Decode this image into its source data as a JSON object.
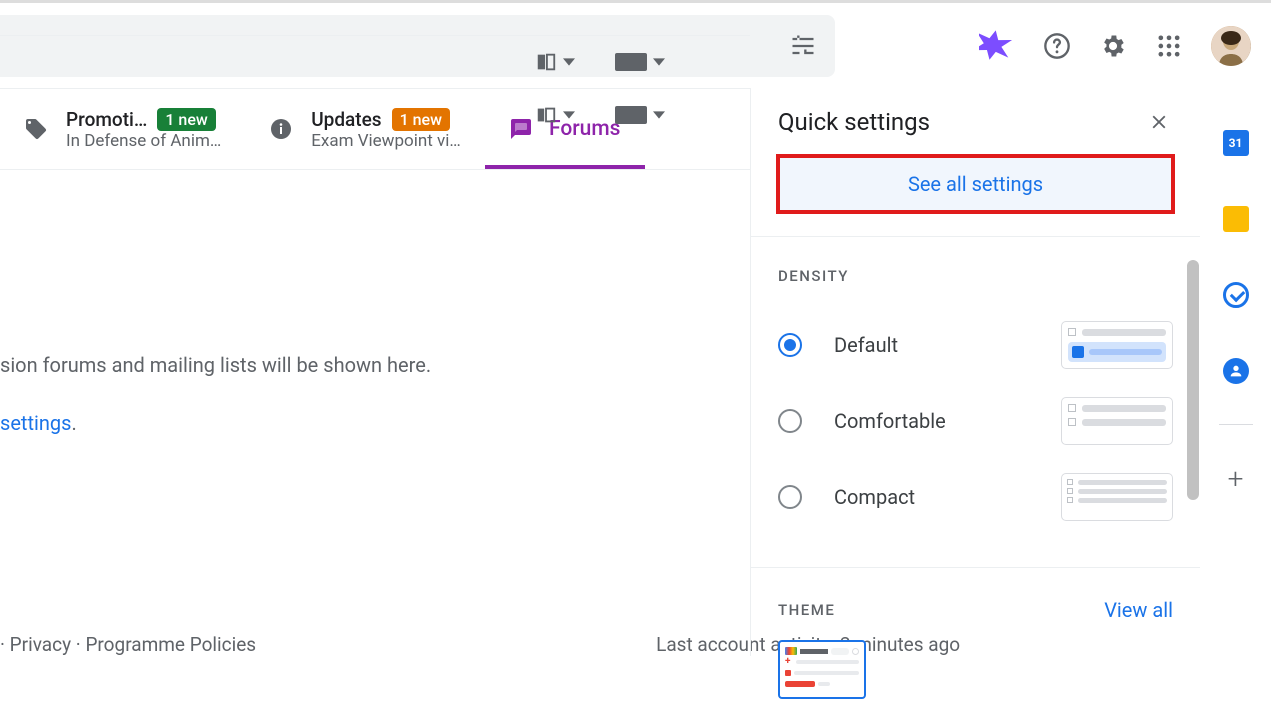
{
  "toolbar": {
    "split_pane_label": "split",
    "input_tools_label": "input"
  },
  "tabs": {
    "promotions": {
      "title": "Promoti…",
      "badge": "1 new",
      "sub": "In Defense of Anim…"
    },
    "updates": {
      "title": "Updates",
      "badge": "1 new",
      "sub": "Exam Viewpoint vi…"
    },
    "forums": {
      "title": "Forums"
    }
  },
  "body": {
    "line1": "sion forums and mailing lists will be shown here.",
    "line2a": " settings",
    "dot": "."
  },
  "footer": {
    "left": " · Privacy · Programme Policies",
    "right": "Last account activity: 2 minutes ago"
  },
  "quick_settings": {
    "title": "Quick settings",
    "see_all": "See all settings",
    "density": {
      "title": "DENSITY",
      "options": [
        "Default",
        "Comfortable",
        "Compact"
      ],
      "selected": 0
    },
    "theme": {
      "title": "THEME",
      "view_all": "View all"
    }
  },
  "side_rail": {
    "calendar_day": "31"
  }
}
